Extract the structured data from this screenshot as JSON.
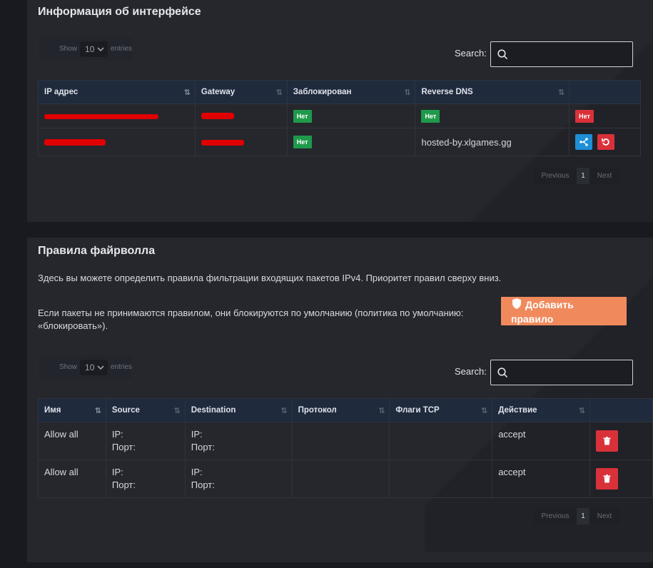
{
  "interface_card": {
    "title": "Информация об интерфейсе",
    "show_label": "Show",
    "entries_value": "10",
    "entries_label": "entries",
    "search_label": "Search:",
    "columns": [
      "IP адрес",
      "Gateway",
      "Заблокирован",
      "Reverse DNS",
      ""
    ],
    "rows": [
      {
        "blocked": "Нет",
        "rdns_badge": "Нет",
        "action_badge": "Нет"
      },
      {
        "blocked": "Нет",
        "rdns": "hosted-by.xlgames.gg"
      }
    ],
    "pager": {
      "prev": "Previous",
      "page": "1",
      "next": "Next"
    }
  },
  "firewall_card": {
    "title": "Правила файрволла",
    "desc1": "Здесь вы можете определить правила фильтрации входящих пакетов IPv4. Приоритет правил сверху вниз.",
    "desc2": "Если пакеты не принимаются правилом, они блокируются по умолчанию (политика по умолчанию: «блокировать»).",
    "add_button": "Добавить правило",
    "show_label": "Show",
    "entries_value": "10",
    "entries_label": "entries",
    "search_label": "Search:",
    "columns": [
      "Имя",
      "Source",
      "Destination",
      "Протокол",
      "Флаги TCP",
      "Действие",
      ""
    ],
    "ip_label": "IP:",
    "port_label": "Порт:",
    "rows": [
      {
        "name": "Allow all",
        "action": "accept"
      },
      {
        "name": "Allow all",
        "action": "accept"
      }
    ],
    "pager": {
      "prev": "Previous",
      "page": "1",
      "next": "Next"
    }
  },
  "colors": {
    "accent_orange": "#f08a5d",
    "green": "#1f9a4a",
    "red": "#d9313a",
    "blue": "#1f8fd6"
  },
  "icons": [
    "search-icon",
    "sort-icon",
    "network-icon",
    "reset-icon",
    "shield-icon",
    "trash-icon",
    "chevron-down-icon"
  ]
}
